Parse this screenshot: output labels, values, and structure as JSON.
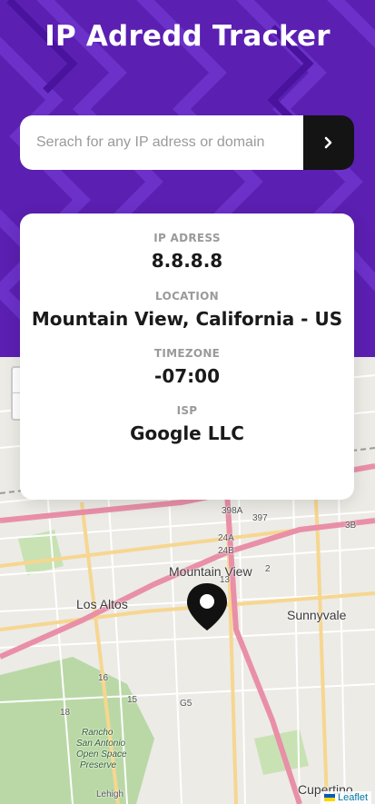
{
  "app": {
    "title": "IP Adredd Tracker"
  },
  "search": {
    "placeholder": "Serach for any IP adress or domain",
    "submit_icon": "chevron-right-icon"
  },
  "info": {
    "ip": {
      "label": "IP ADRESS",
      "value": "8.8.8.8"
    },
    "location": {
      "label": "LOCATION",
      "value": "Mountain View, California - US"
    },
    "timezone": {
      "label": "TIMEZONE",
      "value": "-07:00"
    },
    "isp": {
      "label": "ISP",
      "value": "Google LLC"
    }
  },
  "map": {
    "zoom_in": "+",
    "zoom_out": "−",
    "places": {
      "mountain_view": "Mountain View",
      "los_altos": "Los Altos",
      "sunnyvale": "Sunnyvale",
      "cupertino": "Cupertino",
      "rancho": "Rancho",
      "san_antonio": "San Antonio",
      "open_space": "Open Space",
      "preserve": "Preserve",
      "lehigh": "Lehigh"
    },
    "road_labels": {
      "r397": "397",
      "r398a": "398A",
      "r24a": "24A",
      "r24b": "24B",
      "r13": "13",
      "r2": "2",
      "r3b": "3B",
      "r16": "16",
      "r15": "15",
      "r18": "18",
      "g5": "G5"
    },
    "attribution": "Leaflet",
    "marker_icon": "map-pin-icon",
    "colors": {
      "land": "#ecebe6",
      "highway": "#e98fa8",
      "primary": "#f7d690",
      "green": "#b9d8a6"
    }
  },
  "colors": {
    "header_bg": "#5b1fb1",
    "button_bg": "#141414"
  }
}
